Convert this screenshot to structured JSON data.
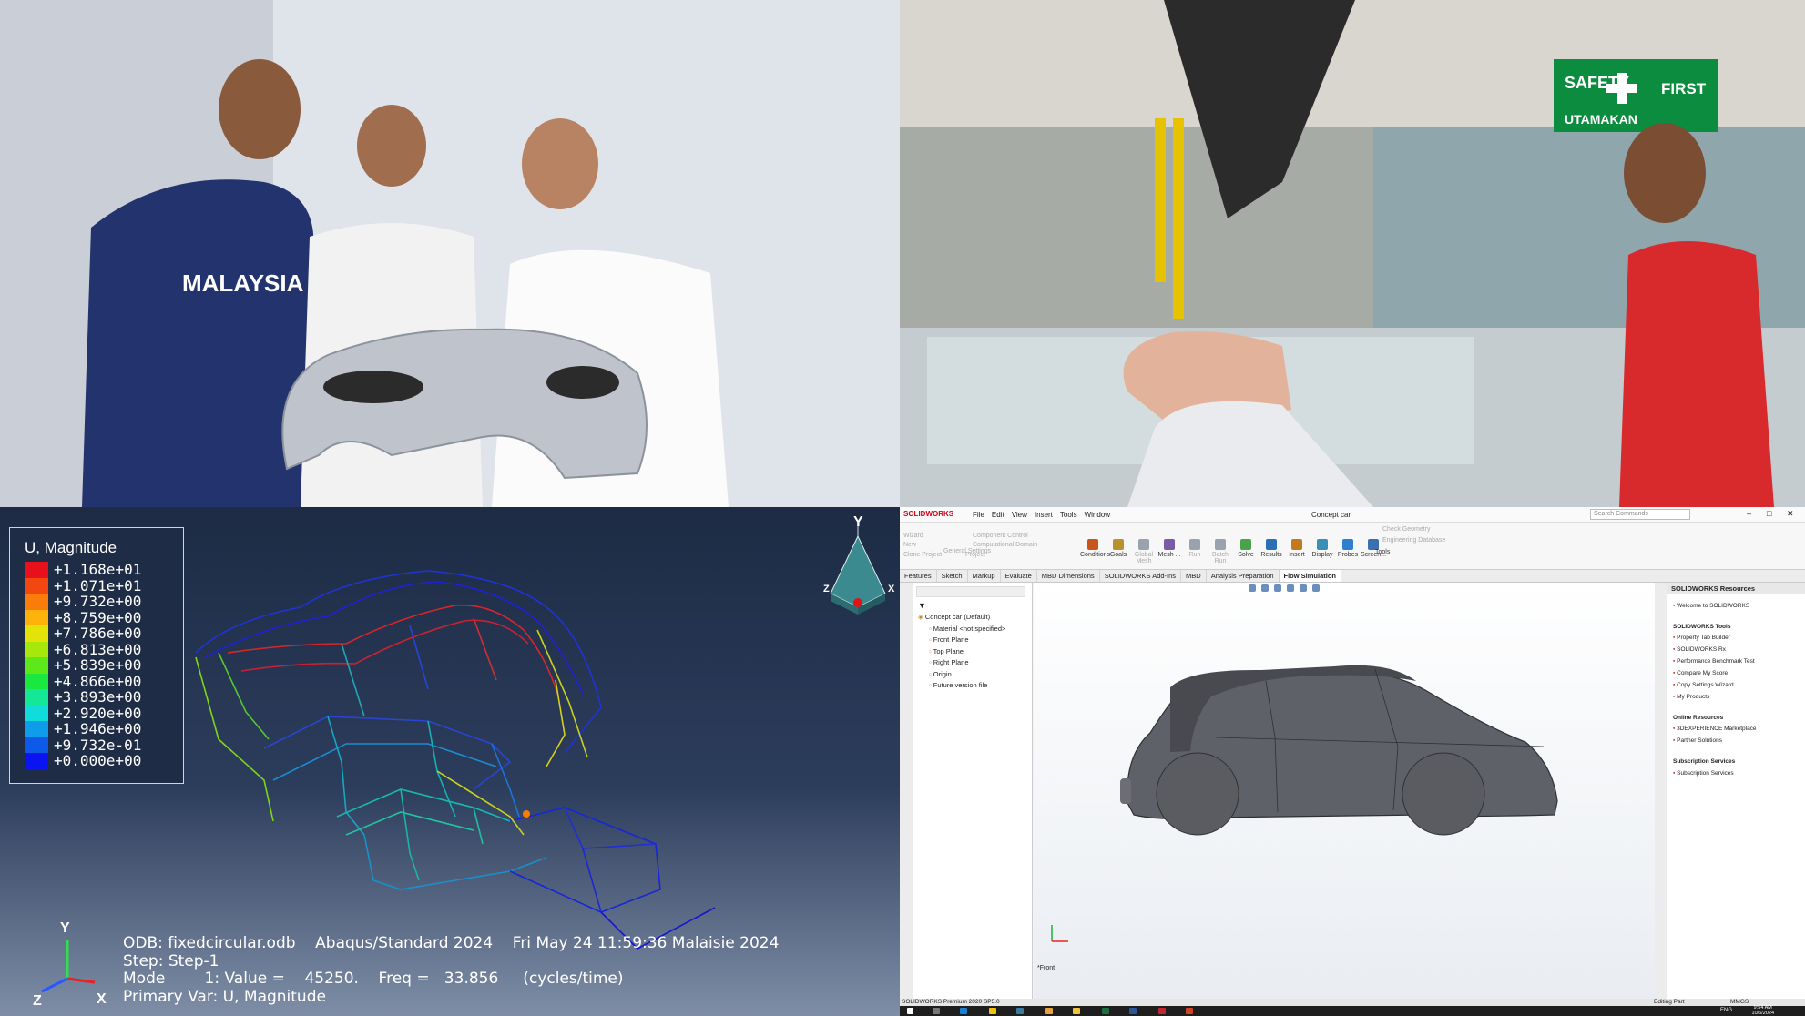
{
  "abaqus": {
    "legend_title": "U, Magnitude",
    "legend": [
      {
        "value": "+1.168e+01",
        "color": "#e8101a"
      },
      {
        "value": "+1.071e+01",
        "color": "#f2470f"
      },
      {
        "value": "+9.732e+00",
        "color": "#fa7d0c"
      },
      {
        "value": "+8.759e+00",
        "color": "#ffb30a"
      },
      {
        "value": "+7.786e+00",
        "color": "#e3e309"
      },
      {
        "value": "+6.813e+00",
        "color": "#a6e80c"
      },
      {
        "value": "+5.839e+00",
        "color": "#5ce81a"
      },
      {
        "value": "+4.866e+00",
        "color": "#1ae83f"
      },
      {
        "value": "+3.893e+00",
        "color": "#14e896"
      },
      {
        "value": "+2.920e+00",
        "color": "#10dcdc"
      },
      {
        "value": "+1.946e+00",
        "color": "#0f9ce8"
      },
      {
        "value": "+9.732e-01",
        "color": "#0d5ae8"
      },
      {
        "value": "+0.000e+00",
        "color": "#0a14f0"
      }
    ],
    "info": {
      "odb": "ODB: fixedcircular.odb",
      "solver": "Abaqus/Standard 2024",
      "date": "Fri May 24 11:59:36 Malaisie 2024",
      "step": "Step: Step-1",
      "mode": "Mode        1: Value =    45250.    Freq =   33.856     (cycles/time)",
      "primary_var": "Primary Var: U, Magnitude"
    },
    "view_cube_axes": [
      "Y",
      "Z",
      "X"
    ],
    "triad_axes": [
      "Y",
      "Z",
      "X"
    ]
  },
  "photos": {
    "left_sign_text": "MALAYSIA",
    "right_sign_line1": "SAFETY",
    "right_sign_line2": "FIRST",
    "right_sign_line3": "UTAMAKAN"
  },
  "solidworks": {
    "brand": "SOLIDWORKS",
    "menu": [
      "File",
      "Edit",
      "View",
      "Insert",
      "Tools",
      "Window"
    ],
    "doc_title": "Concept car",
    "search_placeholder": "Search Commands",
    "ribbon_left": [
      "Wizard",
      "New",
      "Clone Project",
      "General Settings",
      "Component Control",
      "Computational Domain",
      "Project"
    ],
    "ribbon_main": [
      "Conditions",
      "Goals",
      "Global Mesh",
      "Mesh ...",
      "Run",
      "Batch Run",
      "Solve",
      "Results",
      "Insert",
      "Display",
      "Probes",
      "Screen..."
    ],
    "ribbon_right": [
      "Check Geometry",
      "Engineering Database",
      "Tools"
    ],
    "tabs": [
      "Features",
      "Sketch",
      "Markup",
      "Evaluate",
      "MBD Dimensions",
      "SOLIDWORKS Add-Ins",
      "MBD",
      "Analysis Preparation",
      "Flow Simulation"
    ],
    "active_tab": "Flow Simulation",
    "tree": [
      "Concept car  (Default)",
      "Material <not specified>",
      "Front Plane",
      "Top Plane",
      "Right Plane",
      "Origin",
      "Future version file"
    ],
    "view_label": "*Front",
    "resources_title": "SOLIDWORKS Resources",
    "resources": [
      {
        "label": "Welcome to SOLIDWORKS",
        "heading": false
      },
      {
        "label": "SOLIDWORKS Tools",
        "heading": true
      },
      {
        "label": "Property Tab Builder",
        "heading": false
      },
      {
        "label": "SOLIDWORKS Rx",
        "heading": false
      },
      {
        "label": "Performance Benchmark Test",
        "heading": false
      },
      {
        "label": "Compare My Score",
        "heading": false
      },
      {
        "label": "Copy Settings Wizard",
        "heading": false
      },
      {
        "label": "My Products",
        "heading": false
      },
      {
        "label": "Online Resources",
        "heading": true
      },
      {
        "label": "3DEXPERIENCE Marketplace",
        "heading": false
      },
      {
        "label": "Partner Solutions",
        "heading": false
      },
      {
        "label": "Subscription Services",
        "heading": true
      },
      {
        "label": "Subscription Services",
        "heading": false
      }
    ],
    "status_left": "SOLIDWORKS Premium 2020 SP5.0",
    "status_mid": "Editing Part",
    "status_units": "MMGS"
  },
  "taskbar": {
    "lang": "ENG",
    "time": "9:54 AM",
    "date": "10/6/2024"
  }
}
